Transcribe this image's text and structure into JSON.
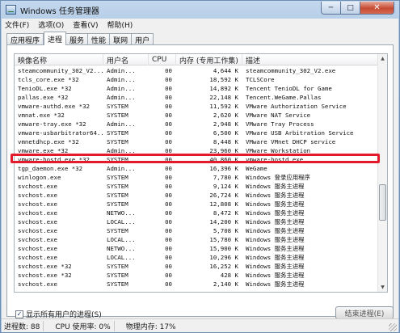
{
  "window": {
    "title": "Windows 任务管理器",
    "minimize_glyph": "─",
    "maximize_glyph": "□",
    "close_glyph": "✕"
  },
  "menu": [
    "文件(F)",
    "选项(O)",
    "查看(V)",
    "帮助(H)"
  ],
  "tabs": [
    "应用程序",
    "进程",
    "服务",
    "性能",
    "联网",
    "用户"
  ],
  "active_tab": "进程",
  "table": {
    "columns": [
      "映像名称",
      "用户名",
      "CPU",
      "内存 (专用工作集)",
      "描述"
    ],
    "rows": [
      [
        "steamcommunity_302_V2...",
        "Admin...",
        "00",
        "4,644 K",
        "steamcommunity_302_V2.exe"
      ],
      [
        "tcls_core.exe *32",
        "Admin...",
        "00",
        "18,592 K",
        "TCLSCore"
      ],
      [
        "TenioDL.exe *32",
        "Admin...",
        "00",
        "14,892 K",
        "Tencent TenioDL for Game"
      ],
      [
        "pallas.exe *32",
        "Admin...",
        "00",
        "22,148 K",
        "Tencent.WeGame.Pallas"
      ],
      [
        "vmware-authd.exe *32",
        "SYSTEM",
        "00",
        "11,592 K",
        "VMware Authorization Service"
      ],
      [
        "vmnat.exe *32",
        "SYSTEM",
        "00",
        "2,620 K",
        "VMware NAT Service"
      ],
      [
        "vmware-tray.exe *32",
        "Admin...",
        "00",
        "2,948 K",
        "VMware Tray Process"
      ],
      [
        "vmware-usbarbitrator64...",
        "SYSTEM",
        "00",
        "6,500 K",
        "VMware USB Arbitration Service"
      ],
      [
        "vmnetdhcp.exe *32",
        "SYSTEM",
        "00",
        "8,448 K",
        "VMware VMnet DHCP service"
      ],
      [
        "vmware.exe *32",
        "Admin...",
        "00",
        "23,960 K",
        "VMware Workstation"
      ],
      [
        "vmware-hostd.exe *32",
        "SYSTEM",
        "00",
        "40,860 K",
        "vmware-hostd.exe"
      ],
      [
        "tgp_daemon.exe *32",
        "Admin...",
        "00",
        "16,396 K",
        "WeGame"
      ],
      [
        "winlogon.exe",
        "SYSTEM",
        "00",
        "7,780 K",
        "Windows 登录应用程序"
      ],
      [
        "svchost.exe",
        "SYSTEM",
        "00",
        "9,124 K",
        "Windows 服务主进程"
      ],
      [
        "svchost.exe",
        "SYSTEM",
        "00",
        "26,724 K",
        "Windows 服务主进程"
      ],
      [
        "svchost.exe",
        "SYSTEM",
        "00",
        "12,808 K",
        "Windows 服务主进程"
      ],
      [
        "svchost.exe",
        "NETWO...",
        "00",
        "8,472 K",
        "Windows 服务主进程"
      ],
      [
        "svchost.exe",
        "LOCAL...",
        "00",
        "14,200 K",
        "Windows 服务主进程"
      ],
      [
        "svchost.exe",
        "SYSTEM",
        "00",
        "5,708 K",
        "Windows 服务主进程"
      ],
      [
        "svchost.exe",
        "LOCAL...",
        "00",
        "15,780 K",
        "Windows 服务主进程"
      ],
      [
        "svchost.exe",
        "NETWO...",
        "00",
        "15,900 K",
        "Windows 服务主进程"
      ],
      [
        "svchost.exe",
        "LOCAL...",
        "00",
        "10,296 K",
        "Windows 服务主进程"
      ],
      [
        "svchost.exe *32",
        "SYSTEM",
        "00",
        "16,252 K",
        "Windows 服务主进程"
      ],
      [
        "svchost.exe *32",
        "SYSTEM",
        "00",
        "428 K",
        "Windows 服务主进程"
      ],
      [
        "svchost.exe",
        "SYSTEM",
        "00",
        "2,140 K",
        "Windows 服务主进程"
      ]
    ],
    "highlighted_row_name": "vmware-hostd.exe *32"
  },
  "show_all_processes": {
    "label": "显示所有用户的进程(S)",
    "checked": true,
    "check_glyph": "✓"
  },
  "end_process_button": "结束进程(E)",
  "status": {
    "process_count": "进程数: 88",
    "cpu_usage": "CPU 使用率: 0%",
    "physical_memory": "物理内存: 17%"
  },
  "colors": {
    "highlight_border": "#e3192c",
    "accent": "#6e8fb5"
  },
  "scroll": {
    "position": 0.66
  }
}
